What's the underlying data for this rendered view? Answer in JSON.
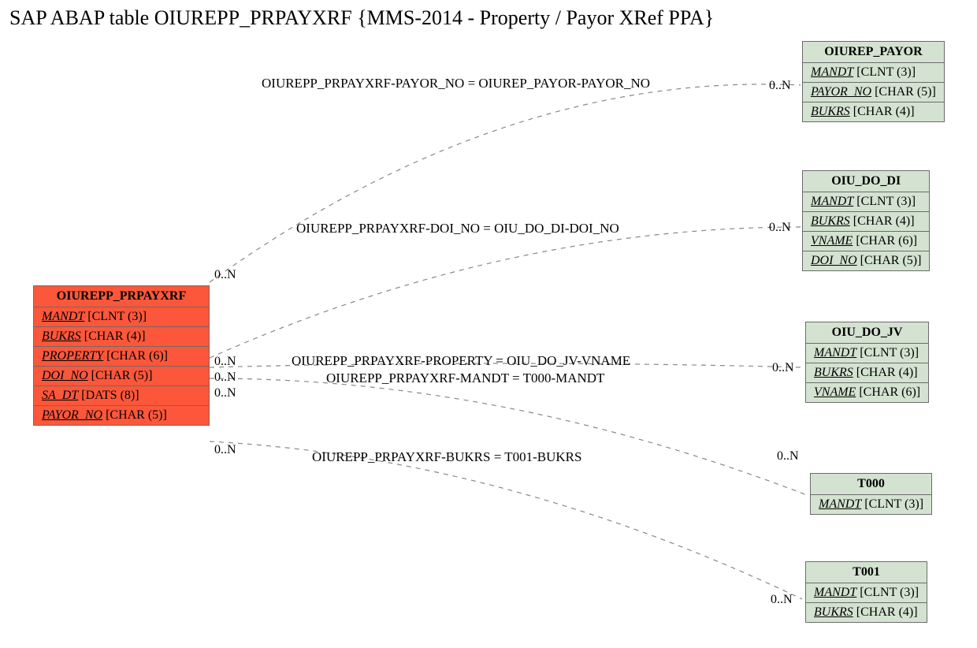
{
  "title": "SAP ABAP table OIUREPP_PRPAYXRF {MMS-2014 - Property / Payor XRef PPA}",
  "mainTable": {
    "name": "OIUREPP_PRPAYXRF",
    "fields": [
      {
        "key": "MANDT",
        "type": "[CLNT (3)]"
      },
      {
        "key": "BUKRS",
        "type": "[CHAR (4)]"
      },
      {
        "key": "PROPERTY",
        "type": "[CHAR (6)]"
      },
      {
        "key": "DOI_NO",
        "type": "[CHAR (5)]"
      },
      {
        "key": "SA_DT",
        "type": "[DATS (8)]"
      },
      {
        "key": "PAYOR_NO",
        "type": "[CHAR (5)]"
      }
    ]
  },
  "refTables": [
    {
      "name": "OIUREP_PAYOR",
      "fields": [
        {
          "key": "MANDT",
          "type": "[CLNT (3)]"
        },
        {
          "key": "PAYOR_NO",
          "type": "[CHAR (5)]"
        },
        {
          "key": "BUKRS",
          "type": "[CHAR (4)]"
        }
      ]
    },
    {
      "name": "OIU_DO_DI",
      "fields": [
        {
          "key": "MANDT",
          "type": "[CLNT (3)]"
        },
        {
          "key": "BUKRS",
          "type": "[CHAR (4)]"
        },
        {
          "key": "VNAME",
          "type": "[CHAR (6)]"
        },
        {
          "key": "DOI_NO",
          "type": "[CHAR (5)]"
        }
      ]
    },
    {
      "name": "OIU_DO_JV",
      "fields": [
        {
          "key": "MANDT",
          "type": "[CLNT (3)]"
        },
        {
          "key": "BUKRS",
          "type": "[CHAR (4)]"
        },
        {
          "key": "VNAME",
          "type": "[CHAR (6)]"
        }
      ]
    },
    {
      "name": "T000",
      "fields": [
        {
          "key": "MANDT",
          "type": "[CLNT (3)]"
        }
      ]
    },
    {
      "name": "T001",
      "fields": [
        {
          "key": "MANDT",
          "type": "[CLNT (3)]"
        },
        {
          "key": "BUKRS",
          "type": "[CHAR (4)]"
        }
      ]
    }
  ],
  "relations": [
    {
      "label": "OIUREPP_PRPAYXRF-PAYOR_NO = OIUREP_PAYOR-PAYOR_NO",
      "leftCard": "0..N",
      "rightCard": "0..N"
    },
    {
      "label": "OIUREPP_PRPAYXRF-DOI_NO = OIU_DO_DI-DOI_NO",
      "leftCard": "0..N",
      "rightCard": "0..N"
    },
    {
      "label": "OIUREPP_PRPAYXRF-PROPERTY = OIU_DO_JV-VNAME",
      "leftCard": "0..N",
      "rightCard": "0..N"
    },
    {
      "label": "OIUREPP_PRPAYXRF-MANDT = T000-MANDT",
      "leftCard": "0..N",
      "rightCard": ""
    },
    {
      "label": "OIUREPP_PRPAYXRF-BUKRS = T001-BUKRS",
      "leftCard": "0..N",
      "rightCard": "0..N"
    }
  ],
  "rightCardT001": "0..N"
}
